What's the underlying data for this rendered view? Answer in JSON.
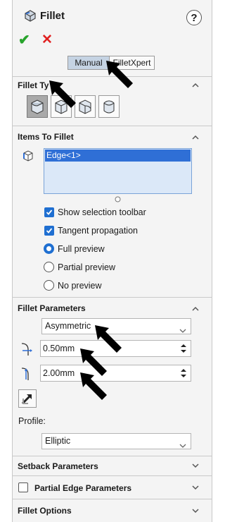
{
  "header": {
    "title": "Fillet",
    "help_glyph": "?"
  },
  "actions": {
    "ok_glyph": "✔",
    "cancel_glyph": "✕"
  },
  "mode_tabs": {
    "manual_label": "Manual",
    "filletxpert_label": "FilletXpert"
  },
  "fillet_type": {
    "header": "Fillet Ty",
    "options": [
      "constant-size-fillet-icon",
      "variable-size-fillet-icon",
      "face-fillet-icon",
      "full-round-fillet-icon"
    ],
    "selected_index": 0
  },
  "items_to_fillet": {
    "header": "Items To Fillet",
    "items": [
      "Edge<1>"
    ],
    "show_selection_toolbar": {
      "label": "Show selection toolbar",
      "checked": true
    },
    "tangent_propagation": {
      "label": "Tangent propagation",
      "checked": true
    },
    "preview_options": [
      {
        "label": "Full preview",
        "selected": true
      },
      {
        "label": "Partial preview",
        "selected": false
      },
      {
        "label": "No preview",
        "selected": false
      }
    ]
  },
  "fillet_parameters": {
    "header": "Fillet Parameters",
    "method_value": "Asymmetric",
    "distance1_value": "0.50mm",
    "distance2_value": "2.00mm",
    "profile_label": "Profile:",
    "profile_value": "Elliptic"
  },
  "collapsed_sections": {
    "setback": "Setback Parameters",
    "partial_edge": {
      "label": "Partial Edge Parameters",
      "checked": false
    },
    "options": "Fillet Options"
  },
  "colors": {
    "accent": "#1f6fd1",
    "ok_green": "#27a32b",
    "cancel_red": "#e02020",
    "list_bg": "#dbe8f8",
    "list_selected": "#2f6fd6"
  }
}
